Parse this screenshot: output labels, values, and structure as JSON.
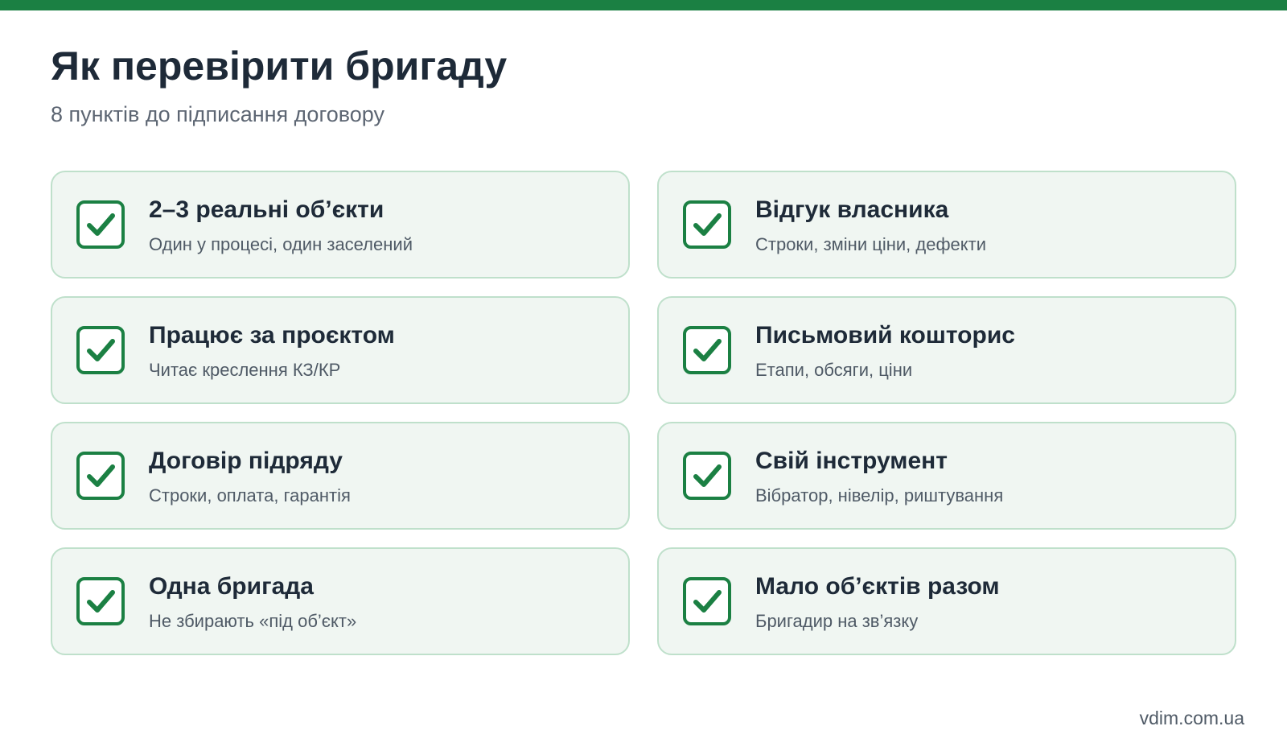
{
  "colors": {
    "accent": "#1b8043",
    "card_background": "#f0f6f2",
    "card_border": "#bfe0cb",
    "title_text": "#1e2a38",
    "body_text": "#4f5a66"
  },
  "header": {
    "title": "Як перевірити бригаду",
    "subtitle": "8 пунктів до підписання договору"
  },
  "items": [
    {
      "title": "2–3 реальні об’єкти",
      "description": "Один у процесі, один заселений",
      "icon": "checkbox-checked-icon"
    },
    {
      "title": "Відгук власника",
      "description": "Строки, зміни ціни, дефекти",
      "icon": "checkbox-checked-icon"
    },
    {
      "title": "Працює за проєктом",
      "description": "Читає креслення КЗ/КР",
      "icon": "checkbox-checked-icon"
    },
    {
      "title": "Письмовий кошторис",
      "description": "Етапи, обсяги, ціни",
      "icon": "checkbox-checked-icon"
    },
    {
      "title": "Договір підряду",
      "description": "Строки, оплата, гарантія",
      "icon": "checkbox-checked-icon"
    },
    {
      "title": "Свій інструмент",
      "description": "Вібратор, нівелір, риштування",
      "icon": "checkbox-checked-icon"
    },
    {
      "title": "Одна бригада",
      "description": "Не збирають «під об’єкт»",
      "icon": "checkbox-checked-icon"
    },
    {
      "title": "Мало об’єктів разом",
      "description": "Бригадир на зв’язку",
      "icon": "checkbox-checked-icon"
    }
  ],
  "footer": {
    "site": "vdim.com.ua"
  }
}
